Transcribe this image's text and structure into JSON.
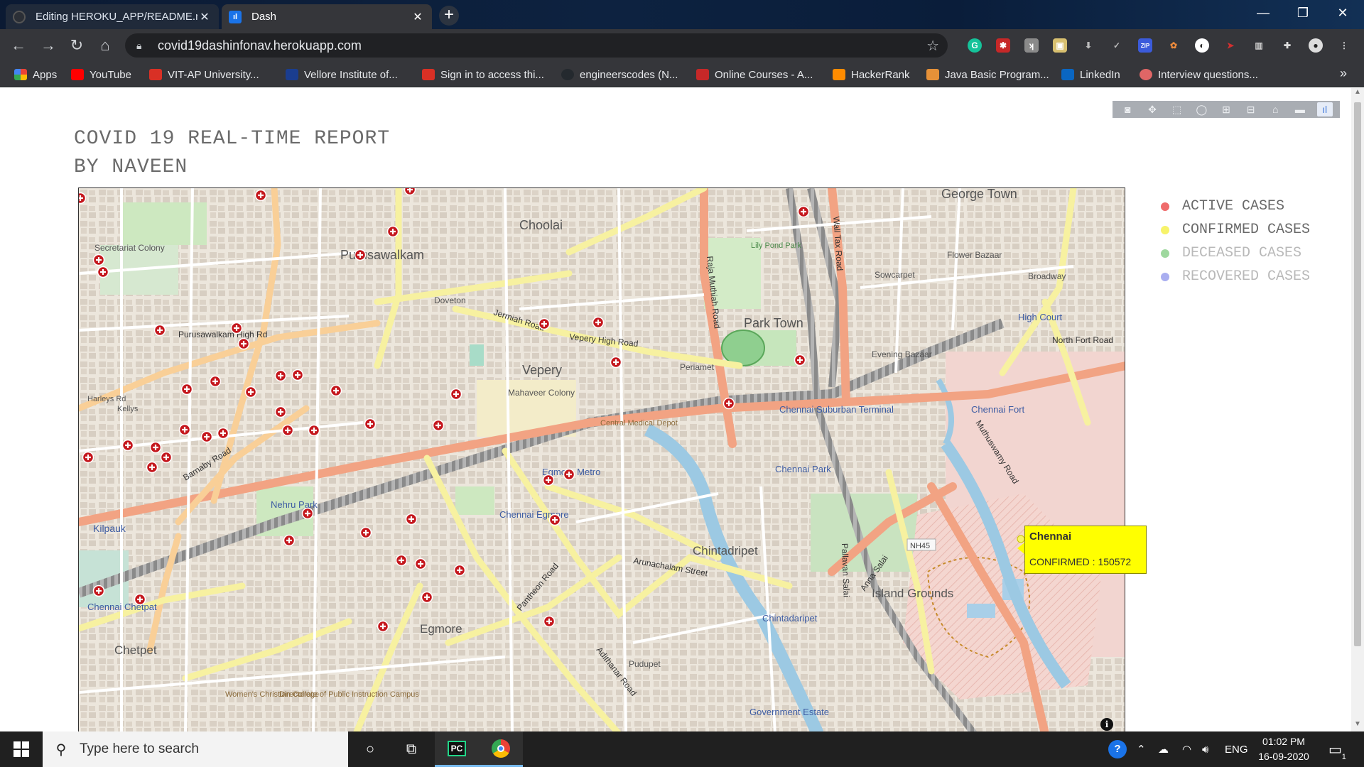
{
  "browser": {
    "tabs": [
      {
        "title": "Editing HEROKU_APP/README.m",
        "close": "✕"
      },
      {
        "title": "Dash",
        "close": "✕"
      }
    ],
    "new_tab": "+",
    "window_controls": {
      "minimize": "—",
      "maximize": "❐",
      "close": "✕"
    },
    "url": "covid19dashinfonav.herokuapp.com",
    "bookmarks": [
      {
        "label": "Apps",
        "color": "#ea4335"
      },
      {
        "label": "YouTube",
        "color": "#ff0000"
      },
      {
        "label": "VIT-AP University...",
        "color": "#d93025"
      },
      {
        "label": "Vellore Institute of...",
        "color": "#1a3d8f"
      },
      {
        "label": "Sign in to access thi...",
        "color": "#d93025"
      },
      {
        "label": "engineerscodes (N...",
        "color": "#24292e"
      },
      {
        "label": "Online Courses - A...",
        "color": "#c62828"
      },
      {
        "label": "HackerRank",
        "color": "#ff8c00"
      },
      {
        "label": "Java Basic Program...",
        "color": "#e69138"
      },
      {
        "label": "LinkedIn",
        "color": "#0a66c2"
      },
      {
        "label": "Interview questions...",
        "color": "#e06666"
      }
    ],
    "bookmarks_more": "»"
  },
  "report": {
    "title_line1": "COVID 19 REAL-TIME REPORT",
    "title_line2": "BY NAVEEN"
  },
  "legend": [
    {
      "label": "ACTIVE CASES",
      "color": "#ef6b6b",
      "text_color": "#6a6a6a"
    },
    {
      "label": "CONFIRMED CASES",
      "color": "#f7f36a",
      "text_color": "#6a6a6a"
    },
    {
      "label": "DECEASED CASES",
      "color": "#9ed89e",
      "text_color": "#b9b9b9"
    },
    {
      "label": "RECOVERED CASES",
      "color": "#a9aef0",
      "text_color": "#b9b9b9"
    }
  ],
  "tooltip": {
    "name": "Chennai",
    "value": "CONFIRMED : 150572"
  },
  "map": {
    "labels": [
      {
        "text": "Choolai"
      },
      {
        "text": "Purusawalkam"
      },
      {
        "text": "Secretariat Colony"
      },
      {
        "text": "Doveton"
      },
      {
        "text": "Vepery"
      },
      {
        "text": "Mahaveer Colony"
      },
      {
        "text": "Periamet"
      },
      {
        "text": "Park Town"
      },
      {
        "text": "George Town"
      },
      {
        "text": "Flower Bazaar"
      },
      {
        "text": "Sowcarpet"
      },
      {
        "text": "High Court"
      },
      {
        "text": "Evening Bazaar"
      },
      {
        "text": "Chennai Fort"
      },
      {
        "text": "Chennai Suburban Terminal"
      },
      {
        "text": "Chennai Park"
      },
      {
        "text": "Egmore Metro"
      },
      {
        "text": "Chennai Egmore"
      },
      {
        "text": "Nehru Park"
      },
      {
        "text": "Kilpauk"
      },
      {
        "text": "Chintadripet"
      },
      {
        "text": "Island Grounds"
      },
      {
        "text": "Chintadaripet"
      },
      {
        "text": "Egmore"
      },
      {
        "text": "Chetpet"
      },
      {
        "text": "Chennai Chetpat"
      },
      {
        "text": "Pudupet"
      },
      {
        "text": "Government Estate"
      },
      {
        "text": "Broadway"
      },
      {
        "text": "Harleys Rd"
      },
      {
        "text": "Kellys"
      },
      {
        "text": "Central Medical Depot"
      },
      {
        "text": "Lily Pond Park"
      },
      {
        "text": "Purusawalkam High Rd"
      },
      {
        "text": "Barnaby Road"
      },
      {
        "text": "Jermiah Road"
      },
      {
        "text": "Vepery High Road"
      },
      {
        "text": "Arunachalam Street"
      },
      {
        "text": "Muthuswamy Road"
      },
      {
        "text": "Anna Salai"
      },
      {
        "text": "Pantheon Road"
      },
      {
        "text": "Adithanar Road"
      },
      {
        "text": "Wall Tax Road"
      },
      {
        "text": "Raja Muthiah Road"
      },
      {
        "text": "Pallavan Salai"
      },
      {
        "text": "North Fort Road"
      },
      {
        "text": "NH45"
      },
      {
        "text": "Women's Christian College"
      },
      {
        "text": "Directorate of Public Instruction Campus"
      }
    ],
    "info": "i"
  },
  "taskbar": {
    "search_placeholder": "Type here to search",
    "tray_lang": "ENG",
    "time": "01:02 PM",
    "date": "16-09-2020",
    "notifications": "1"
  }
}
